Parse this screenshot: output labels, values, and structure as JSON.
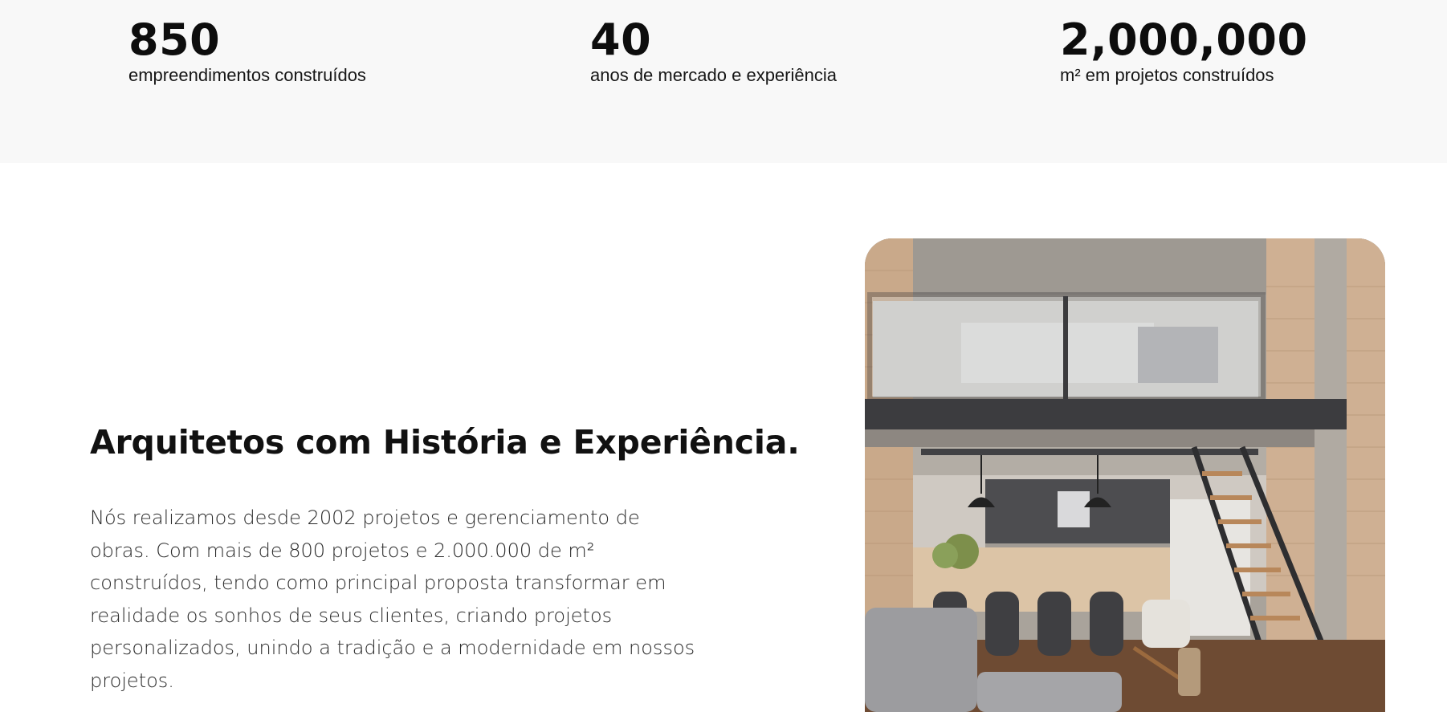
{
  "stats": [
    {
      "value": "850",
      "label": "empreendimentos construídos"
    },
    {
      "value": "40",
      "label": "anos de mercado e experiência"
    },
    {
      "value": "2,000,000",
      "label": "m² em projetos construídos"
    }
  ],
  "about": {
    "title": "Arquitetos com História e Experiência.",
    "body": "Nós realizamos desde 2002 projetos e gerenciamento de obras. Com mais de 800 projetos e 2.000.000 de m² construídos, tendo como principal proposta transformar em realidade os sonhos de seus clientes, criando projetos personalizados, unindo a tradição e a modernidade em nossos projetos."
  },
  "colors": {
    "stats_background": "#f8f8f8",
    "page_background": "#ffffff",
    "text": "#111111"
  }
}
